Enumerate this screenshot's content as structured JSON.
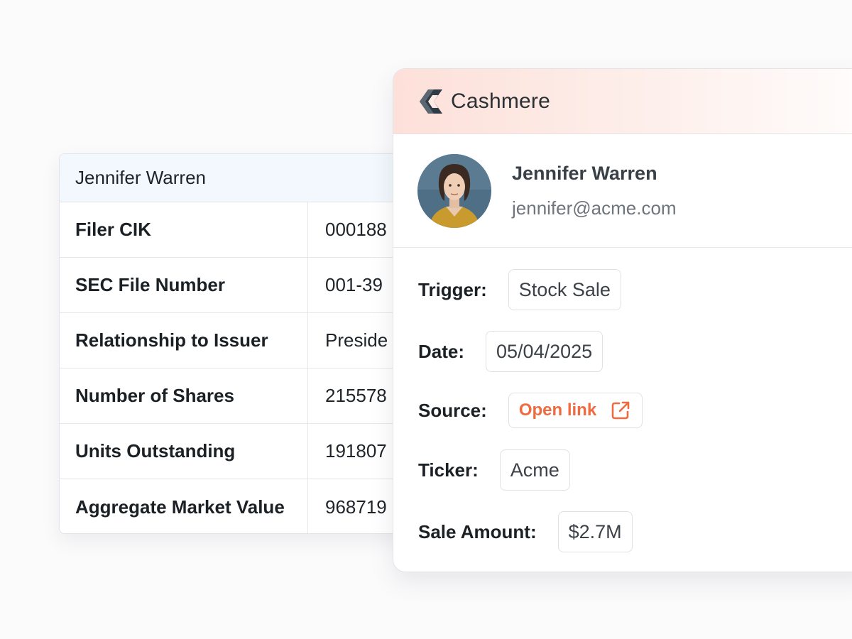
{
  "filing_card": {
    "header": "Jennifer Warren",
    "rows": [
      {
        "label": "Filer CIK",
        "value": "000188"
      },
      {
        "label": "SEC File Number",
        "value": "001-39"
      },
      {
        "label": "Relationship to Issuer",
        "value": "Preside"
      },
      {
        "label": "Number of Shares",
        "value": "215578"
      },
      {
        "label": "Units Outstanding",
        "value": "191807"
      },
      {
        "label": "Aggregate Market Value",
        "value": "968719"
      }
    ]
  },
  "alert_card": {
    "brand": {
      "name": "Cashmere",
      "icon": "cashmere-logo-icon"
    },
    "profile": {
      "name": "Jennifer Warren",
      "email": "jennifer@acme.com",
      "avatar": "avatar-photo"
    },
    "fields": {
      "trigger": {
        "label": "Trigger:",
        "value": "Stock Sale"
      },
      "date": {
        "label": "Date:",
        "value": "05/04/2025"
      },
      "source": {
        "label": "Source:",
        "value": "Open link",
        "icon": "external-link-icon"
      },
      "ticker": {
        "label": "Ticker:",
        "value": "Acme"
      },
      "sale_amount": {
        "label": "Sale Amount:",
        "value": "$2.7M"
      }
    }
  },
  "colors": {
    "accent": "#ef6a3e",
    "header_gradient_start": "#fde0d9",
    "table_header_bg": "#f2f8fd",
    "background": "#fcfbfc"
  }
}
